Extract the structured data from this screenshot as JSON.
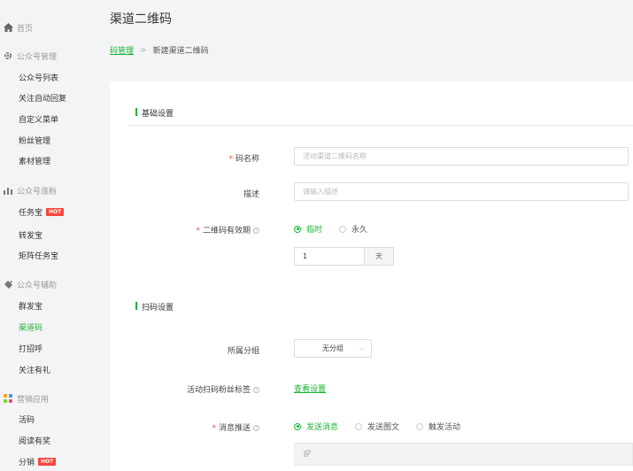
{
  "sidebar": {
    "home": "首页",
    "groups": [
      {
        "label": "公众号管理",
        "icon": "gear-icon",
        "items": [
          "公众号列表",
          "关注自动回复",
          "自定义菜单",
          "粉丝管理",
          "素材管理"
        ]
      },
      {
        "label": "公众号涨粉",
        "icon": "chart-icon",
        "items": [
          "任务宝",
          "转发宝",
          "矩阵任务宝"
        ],
        "hot_item": "任务宝"
      },
      {
        "label": "公众号辅助",
        "icon": "plugin-icon",
        "items": [
          "群发宝",
          "渠道码",
          "打招呼",
          "关注有礼"
        ],
        "active_item": "渠道码"
      },
      {
        "label": "营销应用",
        "icon": "apps-icon",
        "items": [
          "活码",
          "阅读有奖",
          "分销"
        ],
        "hot_item": "分销"
      }
    ],
    "hot_badge": "HOT"
  },
  "header": {
    "title": "渠道二维码",
    "breadcrumb_link": "码管理",
    "breadcrumb_separator": ">",
    "breadcrumb_current": "新建渠道二维码"
  },
  "form": {
    "section_basic": "基础设置",
    "section_scan": "扫码设置",
    "code_name_label": "码名称",
    "code_name_placeholder": "活动渠道二维码名称",
    "desc_label": "描述",
    "desc_placeholder": "请输入描述",
    "validity_label": "二维码有效期",
    "validity_temp": "临时",
    "validity_perm": "永久",
    "days_value": "1",
    "days_unit": "天",
    "group_label": "所属分组",
    "group_value": "无分组",
    "tag_label": "活动扫码粉丝标签",
    "tag_link": "查看设置",
    "push_label": "消息推送",
    "push_opt1": "发送消息",
    "push_opt2": "发送图文",
    "push_opt3": "触发活动",
    "required_mark": "*",
    "help_mark": "?"
  },
  "colors": {
    "accent": "#1db336",
    "hot": "#f5463c"
  }
}
